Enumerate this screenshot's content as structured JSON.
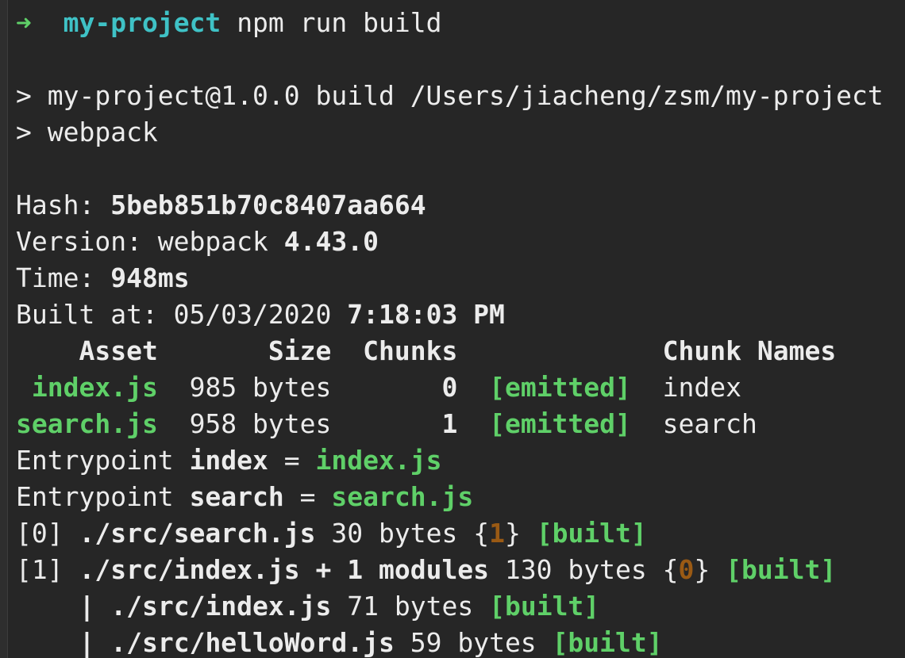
{
  "prompt": {
    "arrow": "➜",
    "directory": "my-project",
    "command": "npm run build"
  },
  "script_lines": [
    "> my-project@1.0.0 build /Users/jiacheng/zsm/my-project",
    "> webpack"
  ],
  "summary": {
    "hash_label": "Hash:",
    "hash_value": "5beb851b70c8407aa664",
    "version_label": "Version: webpack",
    "version_value": "4.43.0",
    "time_label": "Time:",
    "time_value": "948ms",
    "built_label": "Built at: 05/03/2020",
    "built_value": "7:18:03 PM"
  },
  "asset_table": {
    "headers": {
      "asset": "Asset",
      "size": "Size",
      "chunks": "Chunks",
      "chunk_names": "Chunk Names"
    },
    "rows": [
      {
        "asset": "index.js",
        "size": "985 bytes",
        "chunks": "0",
        "status": "[emitted]",
        "chunk_name": "index"
      },
      {
        "asset": "search.js",
        "size": "958 bytes",
        "chunks": "1",
        "status": "[emitted]",
        "chunk_name": "search"
      }
    ]
  },
  "entrypoints": [
    {
      "label": "Entrypoint",
      "name": "index",
      "eq": "=",
      "file": "index.js"
    },
    {
      "label": "Entrypoint",
      "name": "search",
      "eq": "=",
      "file": "search.js"
    }
  ],
  "modules": [
    {
      "id": "[0]",
      "path": "./src/search.js",
      "size": "30 bytes",
      "chunk_open": "{",
      "chunk": "1",
      "chunk_close": "}",
      "status": "[built]"
    },
    {
      "id": "[1]",
      "path": "./src/index.js + 1 modules",
      "size": "130 bytes",
      "chunk_open": "{",
      "chunk": "0",
      "chunk_close": "}",
      "status": "[built]"
    }
  ],
  "submodules": [
    {
      "pipe": "|",
      "path": "./src/index.js",
      "size": "71 bytes",
      "status": "[built]"
    },
    {
      "pipe": "|",
      "path": "./src/helloWord.js",
      "size": "59 bytes",
      "status": "[built]"
    }
  ],
  "colors": {
    "background": "#262626",
    "text": "#ececec",
    "green": "#5fd068",
    "cyan": "#3fc2c6",
    "orange": "#9a5a14"
  }
}
